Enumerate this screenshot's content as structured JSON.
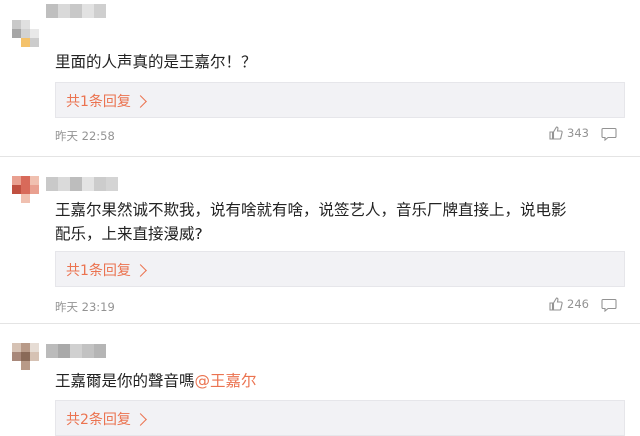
{
  "comments": [
    {
      "text": "里面的人声真的是王嘉尔！？",
      "reply_label": "共1条回复",
      "time": "昨天 22:58",
      "likes": "343",
      "avatar_colors": [
        "#c9c9c9",
        "#f4c26b",
        "#a6a6a6",
        "#e8e8e8"
      ],
      "name_colors": [
        "#bfbfbf",
        "#d9d9d9",
        "#c8c8c8",
        "#e2e2e2",
        "#cfcfcf"
      ]
    },
    {
      "text": "王嘉尔果然诚不欺我，说有啥就有啥，说签艺人，音乐厂牌直接上，说电影\n配乐，上来直接漫威?",
      "reply_label": "共1条回复",
      "time": "昨天 23:19",
      "likes": "246",
      "avatar_colors": [
        "#d86a5a",
        "#e9a090",
        "#c05040",
        "#f0c0b0"
      ],
      "name_colors": [
        "#c9c9c9",
        "#dadada",
        "#bdbdbd",
        "#e3e3e3",
        "#cccccc",
        "#d4d4d4"
      ]
    },
    {
      "text": "王嘉爾是你的聲音嗎",
      "mention": "@王嘉尔",
      "reply_label": "共2条回复",
      "avatar_colors": [
        "#b89a88",
        "#8a6a58",
        "#d6c2b4",
        "#a8887a"
      ],
      "name_colors": [
        "#bbbbbb",
        "#a9a9a9",
        "#d0d0d0",
        "#c2c2c2",
        "#b5b5b5"
      ]
    }
  ],
  "colors": {
    "accent": "#eb7350",
    "meta": "#939393"
  }
}
